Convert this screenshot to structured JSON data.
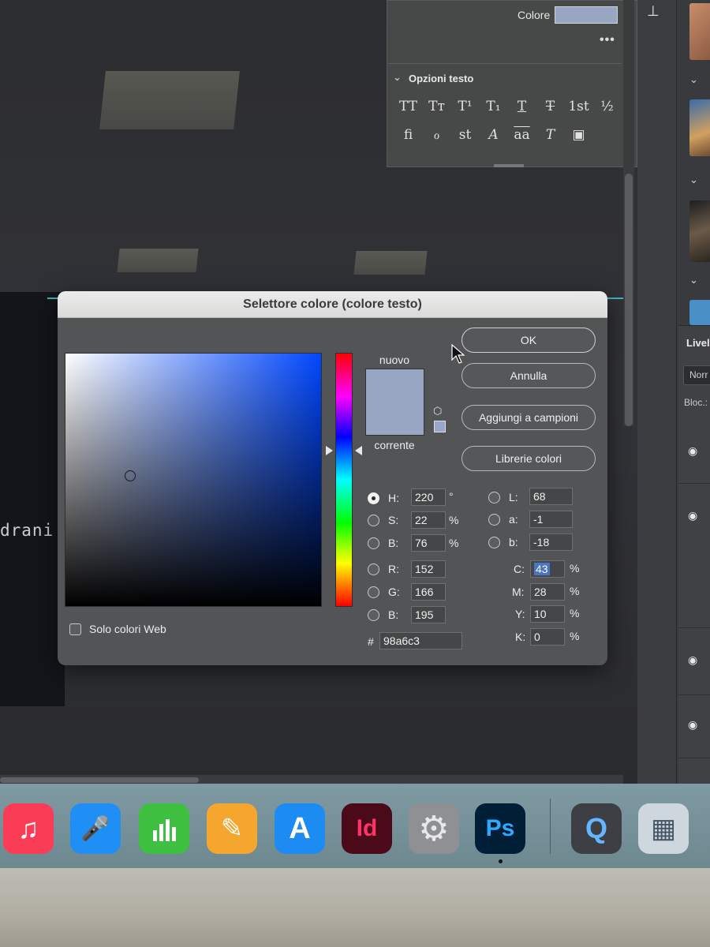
{
  "document": {
    "visible_text": "drani"
  },
  "character_panel": {
    "color_label": "Colore",
    "color_value": "#98a6c3",
    "more": "•••",
    "section_title": "Opzioni testo",
    "row1": [
      "TT",
      "Tт",
      "T¹",
      "T₁",
      "T",
      "T",
      "1st",
      "½"
    ],
    "row2": [
      "ﬁ",
      "ℴ",
      "st",
      "A",
      "aa",
      "T",
      "▣"
    ]
  },
  "layers": {
    "tab": "Livel",
    "blend_mode": "Norr",
    "lock_label": "Bloc.:"
  },
  "dialog": {
    "title": "Selettore colore (colore testo)",
    "label_new": "nuovo",
    "label_current": "corrente",
    "buttons": {
      "ok": "OK",
      "cancel": "Annulla",
      "add_swatch": "Aggiungi a campioni",
      "libraries": "Librerie colori"
    },
    "web_only": "Solo colori Web",
    "hsb": {
      "h_label": "H:",
      "h": "220",
      "h_unit": "°",
      "s_label": "S:",
      "s": "22",
      "s_unit": "%",
      "b_label": "B:",
      "b": "76",
      "b_unit": "%"
    },
    "rgb": {
      "r_label": "R:",
      "r": "152",
      "g_label": "G:",
      "g": "166",
      "b_label": "B:",
      "b": "195"
    },
    "lab": {
      "l_label": "L:",
      "l": "68",
      "a_label": "a:",
      "a": "-1",
      "b_label": "b:",
      "b": "-18"
    },
    "cmyk": {
      "c_label": "C:",
      "c": "43",
      "m_label": "M:",
      "m": "28",
      "y_label": "Y:",
      "y": "10",
      "k_label": "K:",
      "k": "0",
      "unit": "%"
    },
    "hex_label": "#",
    "hex": "98a6c3",
    "selected_radio": "H",
    "new_color": "#98a6c3",
    "current_color": "#98a6c3"
  },
  "dock": {
    "apps": [
      {
        "name": "Music",
        "glyph": "♫",
        "bg": "#fb3c56"
      },
      {
        "name": "Keynote",
        "glyph": "🎤",
        "bg": "#1f8ef5"
      },
      {
        "name": "Numbers",
        "glyph": "▮",
        "bg": "#3fbf3f"
      },
      {
        "name": "Pages",
        "glyph": "✎",
        "bg": "#f5a62e"
      },
      {
        "name": "App Store",
        "glyph": "A",
        "bg": "#1c8cf3"
      },
      {
        "name": "InDesign",
        "glyph": "Id",
        "bg": "#4a0a1a"
      },
      {
        "name": "System Preferences",
        "glyph": "⚙",
        "bg": "#8e9094"
      },
      {
        "name": "Photoshop",
        "glyph": "Ps",
        "bg": "#001e36"
      },
      {
        "name": "QuickTime",
        "glyph": "Q",
        "bg": "#3d3f44"
      },
      {
        "name": "Preview",
        "glyph": "▦",
        "bg": "#cfd7de"
      }
    ]
  }
}
